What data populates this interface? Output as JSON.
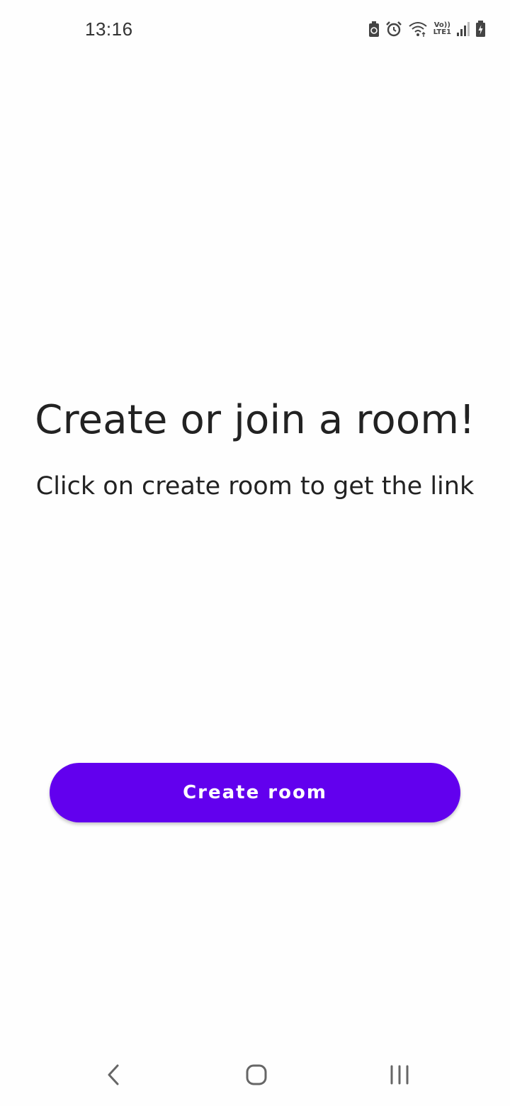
{
  "status_bar": {
    "time": "13:16",
    "volte_top": "Vo))",
    "volte_bottom": "LTE1",
    "icons": [
      "battery-saver-icon",
      "alarm-icon",
      "wifi-icon",
      "volte-icon",
      "signal-icon",
      "battery-charging-icon"
    ]
  },
  "main": {
    "headline": "Create or join a room!",
    "subline": "Click on create room to get the link",
    "button_label": "Create room"
  },
  "nav_bar": {
    "icons": [
      "back-icon",
      "home-icon",
      "recents-icon"
    ]
  },
  "colors": {
    "accent": "#6200ee",
    "background": "#fefefe",
    "text": "#222222"
  }
}
